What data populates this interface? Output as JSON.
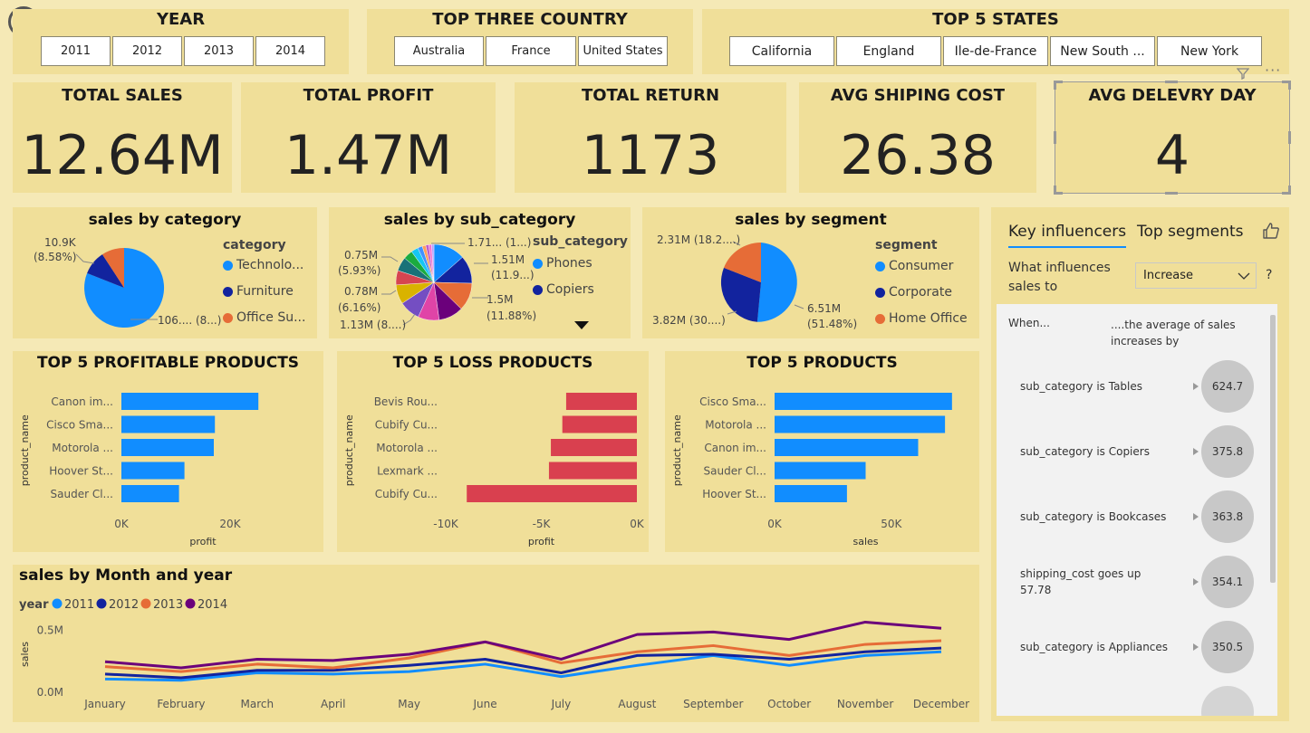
{
  "slicers": {
    "year": {
      "title": "YEAR",
      "options": [
        "2011",
        "2012",
        "2013",
        "2014"
      ]
    },
    "country": {
      "title": "TOP THREE COUNTRY",
      "options": [
        "Australia",
        "France",
        "United States"
      ]
    },
    "states": {
      "title": "TOP 5 STATES",
      "options": [
        "California",
        "England",
        "Ile-de-France",
        "New South ...",
        "New York"
      ]
    }
  },
  "kpis": [
    {
      "title": "TOTAL SALES",
      "value": "12.64M"
    },
    {
      "title": "TOTAL PROFIT",
      "value": "1.47M"
    },
    {
      "title": "TOTAL RETURN",
      "value": "1173"
    },
    {
      "title": "AVG SHIPING COST",
      "value": "26.38"
    },
    {
      "title": "AVG DELEVRY DAY",
      "value": "4"
    }
  ],
  "pie_category": {
    "title": "sales by category",
    "legend_title": "category",
    "legend": [
      {
        "name": "Technolo...",
        "color": "#118dff"
      },
      {
        "name": "Furniture",
        "color": "#12239e"
      },
      {
        "name": "Office Su...",
        "color": "#e66c37"
      }
    ],
    "labels": [
      "10.9K",
      "(8.58%)",
      "106.... (8...)"
    ]
  },
  "pie_subcat": {
    "title": "sales by sub_category",
    "legend_title": "sub_category",
    "legend": [
      {
        "name": "Phones",
        "color": "#118dff"
      },
      {
        "name": "Copiers",
        "color": "#12239e"
      }
    ],
    "labels_left": [
      "0.75M",
      "(5.93%)",
      "0.78M",
      "(6.16%)",
      "1.13M (8....)"
    ],
    "labels_right": [
      "1.71... (1...)",
      "1.51M",
      "(11.9...)",
      "1.5M",
      "(11.88%)"
    ]
  },
  "pie_segment": {
    "title": "sales by segment",
    "legend_title": "segment",
    "legend": [
      {
        "name": "Consumer",
        "color": "#118dff"
      },
      {
        "name": "Corporate",
        "color": "#12239e"
      },
      {
        "name": "Home Office",
        "color": "#e66c37"
      }
    ],
    "labels": [
      "2.31M (18.2....)",
      "6.51M",
      "(51.48%)",
      "3.82M (30....)"
    ]
  },
  "key_influencers": {
    "tabs": [
      "Key influencers",
      "Top segments"
    ],
    "question": "What influences sales to",
    "dropdown": "Increase",
    "help": "?",
    "col_when": "When...",
    "col_avg": "....the average of sales increases by",
    "rows": [
      {
        "text": "sub_category is Tables",
        "value": "624.7"
      },
      {
        "text": "sub_category is Copiers",
        "value": "375.8"
      },
      {
        "text": "sub_category is Bookcases",
        "value": "363.8"
      },
      {
        "text": "shipping_cost goes up 57.78",
        "value": "354.1"
      },
      {
        "text": "sub_category is Appliances",
        "value": "350.5"
      }
    ]
  },
  "chart_data": [
    {
      "type": "bar",
      "orientation": "horizontal",
      "title": "TOP 5 PROFITABLE PRODUCTS",
      "xlabel": "profit",
      "ylabel": "product_name",
      "color": "#118dff",
      "categories": [
        "Canon im...",
        "Cisco Sma...",
        "Motorola ...",
        "Hoover St...",
        "Sauder Cl..."
      ],
      "values": [
        25200,
        17200,
        17000,
        11600,
        10600
      ],
      "xlim": [
        0,
        30000
      ],
      "ticks": [
        0,
        20000
      ],
      "tick_labels": [
        "0K",
        "20K"
      ]
    },
    {
      "type": "bar",
      "orientation": "horizontal",
      "title": "TOP 5 LOSS PRODUCTS",
      "xlabel": "profit",
      "ylabel": "product_name",
      "color": "#d9404f",
      "categories": [
        "Bevis Rou...",
        "Cubify Cu...",
        "Motorola ...",
        "Lexmark ...",
        "Cubify Cu..."
      ],
      "values": [
        -3700,
        -3900,
        -4500,
        -4600,
        -8900
      ],
      "xlim": [
        -10000,
        0
      ],
      "ticks": [
        -10000,
        -5000,
        0
      ],
      "tick_labels": [
        "-10K",
        "-5K",
        "0K"
      ]
    },
    {
      "type": "bar",
      "orientation": "horizontal",
      "title": "TOP 5 PRODUCTS",
      "xlabel": "sales",
      "ylabel": "product_name",
      "color": "#118dff",
      "categories": [
        "Cisco Sma...",
        "Motorola ...",
        "Canon im...",
        "Sauder Cl...",
        "Hoover St..."
      ],
      "values": [
        76000,
        73000,
        61500,
        39000,
        31000
      ],
      "xlim": [
        0,
        78000
      ],
      "ticks": [
        0,
        50000
      ],
      "tick_labels": [
        "0K",
        "50K"
      ]
    },
    {
      "type": "line",
      "title": "sales by Month and year",
      "ylabel": "sales",
      "legend_title": "year",
      "categories": [
        "January",
        "February",
        "March",
        "April",
        "May",
        "June",
        "July",
        "August",
        "September",
        "October",
        "November",
        "December"
      ],
      "ylim": [
        0,
        0.6
      ],
      "y_ticks": [
        0,
        0.5
      ],
      "y_tick_labels": [
        "0.0M",
        "0.5M"
      ],
      "series": [
        {
          "name": "2011",
          "color": "#118dff",
          "values": [
            0.1,
            0.09,
            0.15,
            0.14,
            0.16,
            0.22,
            0.12,
            0.21,
            0.29,
            0.21,
            0.29,
            0.32
          ]
        },
        {
          "name": "2012",
          "color": "#12239e",
          "values": [
            0.14,
            0.11,
            0.17,
            0.17,
            0.21,
            0.26,
            0.15,
            0.29,
            0.3,
            0.26,
            0.32,
            0.35
          ]
        },
        {
          "name": "2013",
          "color": "#e66c37",
          "values": [
            0.2,
            0.16,
            0.22,
            0.19,
            0.27,
            0.4,
            0.23,
            0.32,
            0.37,
            0.29,
            0.38,
            0.41
          ]
        },
        {
          "name": "2014",
          "color": "#6b007b",
          "values": [
            0.24,
            0.19,
            0.26,
            0.25,
            0.3,
            0.4,
            0.26,
            0.46,
            0.48,
            0.42,
            0.56,
            0.51
          ]
        }
      ]
    }
  ]
}
